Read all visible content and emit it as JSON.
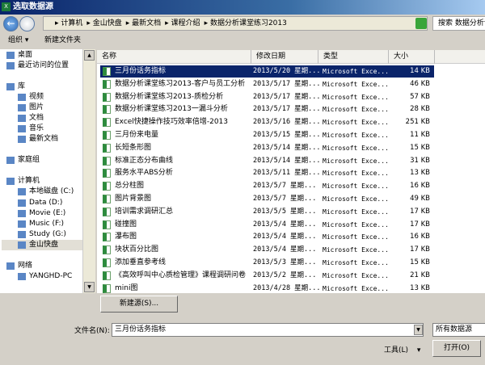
{
  "window": {
    "title": "选取数据源",
    "icon": "excel-icon"
  },
  "address": {
    "crumbs": [
      "计算机",
      "金山快盘",
      "最新文档",
      "课程介绍",
      "数据分析课堂练习2013"
    ],
    "search_placeholder": "搜索 数据分析课堂练习2013"
  },
  "toolbar": {
    "organize": "组织 ▾",
    "new_folder": "新建文件夹"
  },
  "nav": {
    "items": [
      {
        "label": "桌面",
        "level": "top"
      },
      {
        "label": "最近访问的位置",
        "level": "top"
      },
      {
        "label": "库",
        "level": "group"
      },
      {
        "label": "视频"
      },
      {
        "label": "图片"
      },
      {
        "label": "文档"
      },
      {
        "label": "音乐"
      },
      {
        "label": "最新文档"
      },
      {
        "label": "家庭组",
        "level": "group"
      },
      {
        "label": "计算机",
        "level": "group"
      },
      {
        "label": "本地磁盘 (C:)"
      },
      {
        "label": "Data (D:)"
      },
      {
        "label": "Movie (E:)"
      },
      {
        "label": "Music (F:)"
      },
      {
        "label": "Study (G:)"
      },
      {
        "label": "金山快盘",
        "selected": true
      },
      {
        "label": "网络",
        "level": "group"
      },
      {
        "label": "YANGHD-PC"
      }
    ]
  },
  "columns": {
    "name": "名称",
    "date": "修改日期",
    "type": "类型",
    "size": "大小"
  },
  "files": [
    {
      "name": "三月份话务指标",
      "date": "2013/5/20 星期...",
      "type": "Microsoft Exce...",
      "size": "14 KB",
      "selected": true
    },
    {
      "name": "数据分析课堂练习2013-客户与员工分析",
      "date": "2013/5/17 星期...",
      "type": "Microsoft Exce...",
      "size": "46 KB"
    },
    {
      "name": "数据分析课堂练习2013-质检分析",
      "date": "2013/5/17 星期...",
      "type": "Microsoft Exce...",
      "size": "57 KB"
    },
    {
      "name": "数据分析课堂练习2013一漏斗分析",
      "date": "2013/5/17 星期...",
      "type": "Microsoft Exce...",
      "size": "28 KB"
    },
    {
      "name": "Excel快捷操作技巧效率倍增-2013",
      "date": "2013/5/16 星期...",
      "type": "Microsoft Exce...",
      "size": "251 KB"
    },
    {
      "name": "三月份来电量",
      "date": "2013/5/15 星期...",
      "type": "Microsoft Exce...",
      "size": "11 KB"
    },
    {
      "name": "长短条形图",
      "date": "2013/5/14 星期...",
      "type": "Microsoft Exce...",
      "size": "15 KB"
    },
    {
      "name": "标准正态分布曲线",
      "date": "2013/5/14 星期...",
      "type": "Microsoft Exce...",
      "size": "31 KB"
    },
    {
      "name": "服务水平ABS分析",
      "date": "2013/5/11 星期...",
      "type": "Microsoft Exce...",
      "size": "13 KB"
    },
    {
      "name": "总分柱图",
      "date": "2013/5/7 星期...",
      "type": "Microsoft Exce...",
      "size": "16 KB"
    },
    {
      "name": "图片背景图",
      "date": "2013/5/7 星期...",
      "type": "Microsoft Exce...",
      "size": "49 KB"
    },
    {
      "name": "培训需求调研汇总",
      "date": "2013/5/5 星期...",
      "type": "Microsoft Exce...",
      "size": "17 KB"
    },
    {
      "name": "碰撞图",
      "date": "2013/5/4 星期...",
      "type": "Microsoft Exce...",
      "size": "17 KB"
    },
    {
      "name": "瀑布图",
      "date": "2013/5/4 星期...",
      "type": "Microsoft Exce...",
      "size": "16 KB"
    },
    {
      "name": "块状百分比图",
      "date": "2013/5/4 星期...",
      "type": "Microsoft Exce...",
      "size": "17 KB"
    },
    {
      "name": "添加垂直参考线",
      "date": "2013/5/3 星期...",
      "type": "Microsoft Exce...",
      "size": "15 KB"
    },
    {
      "name": "《高效呼叫中心质检管理》课程调研问卷",
      "date": "2013/5/2 星期...",
      "type": "Microsoft Exce...",
      "size": "21 KB"
    },
    {
      "name": "mini图",
      "date": "2013/4/28 星期...",
      "type": "Microsoft Exce...",
      "size": "13 KB"
    }
  ],
  "footer": {
    "new_source": "新建源(S)...",
    "filename_label": "文件名(N):",
    "filename_value": "三月份话务指标",
    "filter": "所有数据源",
    "tools": "工具(L)",
    "open": "打开(O)"
  }
}
